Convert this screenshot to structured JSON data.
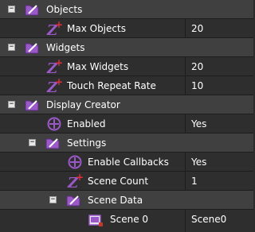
{
  "rows": [
    {
      "label": "Objects"
    },
    {
      "label": "Max Objects",
      "value": "20"
    },
    {
      "label": "Widgets"
    },
    {
      "label": "Max Widgets",
      "value": "20"
    },
    {
      "label": "Touch Repeat Rate",
      "value": "10"
    },
    {
      "label": "Display Creator"
    },
    {
      "label": "Enabled",
      "value": "Yes"
    },
    {
      "label": "Settings"
    },
    {
      "label": "Enable Callbacks",
      "value": "Yes"
    },
    {
      "label": "Scene Count",
      "value": "1"
    },
    {
      "label": "Scene Data"
    },
    {
      "label": "Scene 0",
      "value": "Scene0"
    }
  ],
  "colors": {
    "folder": "#9b59c7",
    "z_icon": "#9b59c7",
    "plus": "#e0303b",
    "enabled_icon": "#9b59c7"
  },
  "toggle_glyph": "−",
  "icon_names": [
    "folder-icon",
    "integer-property-icon",
    "boolean-property-icon",
    "scene-icon"
  ]
}
